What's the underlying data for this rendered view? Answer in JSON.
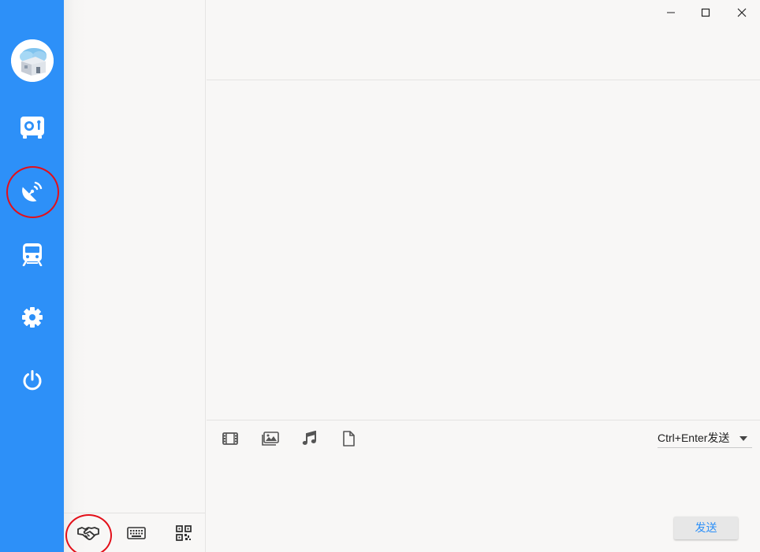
{
  "window_controls": {
    "minimize_icon": "minimize-icon",
    "maximize_icon": "maximize-icon",
    "close_icon": "close-icon"
  },
  "rail": {
    "color": "#2d90f8",
    "items": [
      {
        "name": "safe-icon"
      },
      {
        "name": "satellite-dish-icon"
      },
      {
        "name": "train-icon"
      },
      {
        "name": "gear-icon"
      },
      {
        "name": "power-icon"
      }
    ]
  },
  "list_footer": {
    "items": [
      {
        "name": "handshake-icon"
      },
      {
        "name": "keyboard-icon"
      },
      {
        "name": "qr-code-icon"
      }
    ]
  },
  "composer": {
    "tools": [
      {
        "name": "video-file-icon"
      },
      {
        "name": "image-icon"
      },
      {
        "name": "music-icon"
      },
      {
        "name": "file-icon"
      }
    ],
    "send_mode": "Ctrl+Enter发送",
    "send_label": "发送"
  },
  "colors": {
    "accent": "#2d90f8",
    "annotation": "#e3101a"
  }
}
